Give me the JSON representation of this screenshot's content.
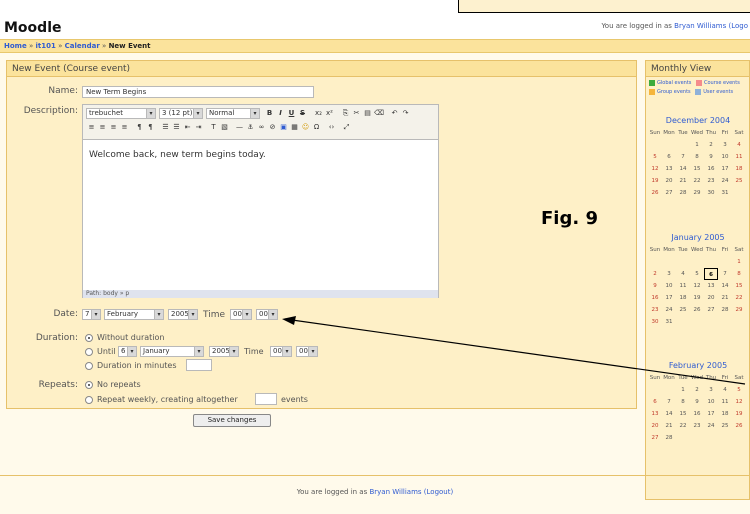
{
  "site": {
    "title": "Moodle",
    "login_prefix": "You are logged in as",
    "user": "Bryan Williams",
    "logout_top": "(Logo",
    "logout": "(Logout)"
  },
  "breadcrumb": [
    {
      "label": "Home"
    },
    {
      "label": "it101"
    },
    {
      "label": "Calendar"
    },
    {
      "label": "New Event"
    }
  ],
  "breadcrumb_sep": "»",
  "form": {
    "title": "New Event (Course event)",
    "name_label": "Name:",
    "name_value": "New Term Begins",
    "description_label": "Description:",
    "font_family": "trebuchet",
    "font_size": "3 (12 pt)",
    "style": "Normal",
    "content": "Welcome back, new term begins today.",
    "path": "Path: body » p",
    "date_label": "Date:",
    "date_day": "7",
    "date_month": "February",
    "date_year": "2005",
    "time_label": "Time",
    "date_hour": "00",
    "date_minute": "00",
    "duration_label": "Duration:",
    "without_duration": "Without duration",
    "until_label": "Until",
    "until_day": "6",
    "until_month": "January",
    "until_year": "2005",
    "until_time_label": "Time",
    "until_hour": "00",
    "until_minute": "00",
    "duration_minutes": "Duration in minutes",
    "repeats_label": "Repeats:",
    "no_repeats": "No repeats",
    "repeat_weekly_pre": "Repeat weekly, creating altogether",
    "repeat_weekly_post": "events",
    "save_button": "Save changes"
  },
  "toolbar_icons": [
    "bold-icon",
    "italic-icon",
    "underline-icon",
    "strike-icon",
    "subscript-icon",
    "superscript-icon",
    "copy-icon",
    "cut-icon",
    "paste-icon",
    "clean-icon",
    "undo-icon",
    "redo-icon"
  ],
  "sidebar": {
    "title": "Monthly View",
    "legend": [
      {
        "label": "Global events",
        "color": "#3cab3c"
      },
      {
        "label": "Course events",
        "color": "#f58b8b"
      },
      {
        "label": "Group events",
        "color": "#f5b53c"
      },
      {
        "label": "User events",
        "color": "#8fb1d8"
      }
    ],
    "weekdays": [
      "Sun",
      "Mon",
      "Tue",
      "Wed",
      "Thu",
      "Fri",
      "Sat"
    ],
    "months": [
      {
        "title": "December 2004",
        "rows": [
          [
            "",
            "",
            "",
            "1",
            "2",
            "3",
            "4"
          ],
          [
            "5",
            "6",
            "7",
            "8",
            "9",
            "10",
            "11"
          ],
          [
            "12",
            "13",
            "14",
            "15",
            "16",
            "17",
            "18"
          ],
          [
            "19",
            "20",
            "21",
            "22",
            "23",
            "24",
            "25"
          ],
          [
            "26",
            "27",
            "28",
            "29",
            "30",
            "31",
            ""
          ]
        ]
      },
      {
        "title": "January 2005",
        "rows": [
          [
            "",
            "",
            "",
            "",
            "",
            "",
            "1"
          ],
          [
            "2",
            "3",
            "4",
            "5",
            "6",
            "7",
            "8"
          ],
          [
            "9",
            "10",
            "11",
            "12",
            "13",
            "14",
            "15"
          ],
          [
            "16",
            "17",
            "18",
            "19",
            "20",
            "21",
            "22"
          ],
          [
            "23",
            "24",
            "25",
            "26",
            "27",
            "28",
            "29"
          ],
          [
            "30",
            "31",
            "",
            "",
            "",
            "",
            ""
          ]
        ],
        "today": "6"
      },
      {
        "title": "February 2005",
        "rows": [
          [
            "",
            "",
            "1",
            "2",
            "3",
            "4",
            "5"
          ],
          [
            "6",
            "7",
            "8",
            "9",
            "10",
            "11",
            "12"
          ],
          [
            "13",
            "14",
            "15",
            "16",
            "17",
            "18",
            "19"
          ],
          [
            "20",
            "21",
            "22",
            "23",
            "24",
            "25",
            "26"
          ],
          [
            "27",
            "28",
            "",
            "",
            "",
            "",
            ""
          ]
        ]
      }
    ]
  },
  "figure_label": "Fig. 9",
  "footer": {
    "prefix": "You are logged in as",
    "user": "Bryan Williams",
    "logout": "(Logout)"
  }
}
